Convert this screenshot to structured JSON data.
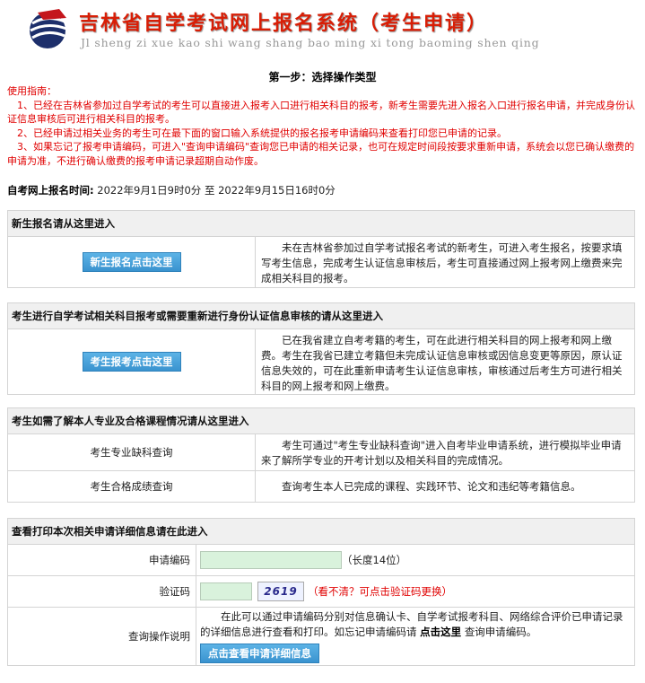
{
  "header": {
    "title_cn": "吉林省自学考试网上报名系统（考生申请）",
    "title_pinyin": "Jl sheng zi xue kao shi wang shang bao ming xi tong baoming shen qing"
  },
  "step_title": "第一步：选择操作类型",
  "guide": {
    "heading": "使用指南：",
    "items": [
      "1、已经在吉林省参加过自学考试的考生可以直接进入报考入口进行相关科目的报考，新考生需要先进入报名入口进行报名申请，并完成身份认证信息审核后可进行相关科目的报考。",
      "2、已经申请过相关业务的考生可在最下面的窗口输入系统提供的报名报考申请编码来查看打印您已申请的记录。",
      "3、如果忘记了报考申请编码，可进入\"查询申请编码\"查询您已申请的相关记录，也可在规定时间段按要求重新申请，系统会以您已确认缴费的申请为准，不进行确认缴费的报考申请记录超期自动作废。"
    ]
  },
  "reg_time": {
    "label": "自考网上报名时间:",
    "value": "2022年9月1日9时0分 至 2022年9月15日16时0分"
  },
  "panel_new": {
    "head": "新生报名请从这里进入",
    "button": "新生报名点击这里",
    "desc": "未在吉林省参加过自学考试报名考试的新考生，可进入考生报名，按要求填写考生信息，完成考生认证信息审核后，考生可直接通过网上报考网上缴费来完成相关科目的报考。"
  },
  "panel_exam": {
    "head": "考生进行自学考试相关科目报考或需要重新进行身份认证信息审核的请从这里进入",
    "button": "考生报考点击这里",
    "desc": "已在我省建立自考考籍的考生，可在此进行相关科目的网上报考和网上缴费。考生在我省已建立考籍但未完成认证信息审核或因信息变更等原因，原认证信息失效的，可在此重新申请考生认证信息审核，审核通过后考生方可进行相关科目的网上报考和网上缴费。"
  },
  "panel_query": {
    "head": "考生如需了解本人专业及合格课程情况请从这里进入",
    "rows": [
      {
        "label": "考生专业缺科查询",
        "desc": "考生可通过\"考生专业缺科查询\"进入自考毕业申请系统，进行模拟毕业申请来了解所学专业的开考计划以及相关科目的完成情况。"
      },
      {
        "label": "考生合格成绩查询",
        "desc": "查询考生本人已完成的课程、实践环节、论文和违纪等考籍信息。"
      }
    ]
  },
  "panel_print": {
    "head": "查看打印本次相关申请详细信息请在此进入",
    "code_label": "申请编码",
    "code_value": "",
    "code_hint": "（长度14位）",
    "verify_label": "验证码",
    "verify_value": "",
    "captcha_text": "2619",
    "captcha_hint": "（看不清？可点击验证码更换）",
    "help_label": "查询操作说明",
    "help_text_1": "在此可以通过申请编码分别对信息确认卡、自学考试报考科目、网络综合评价已申请记录的详细信息进行查看和打印。如忘记申请编码请",
    "help_link": "点击这里",
    "help_text_2": "查询申请编码。",
    "button": "点击查看申请详细信息"
  },
  "colors": {
    "accent": "#d81e06",
    "button": "#3a93cf",
    "guide_text": "#e00000",
    "input_bg": "#d9f2dc"
  }
}
